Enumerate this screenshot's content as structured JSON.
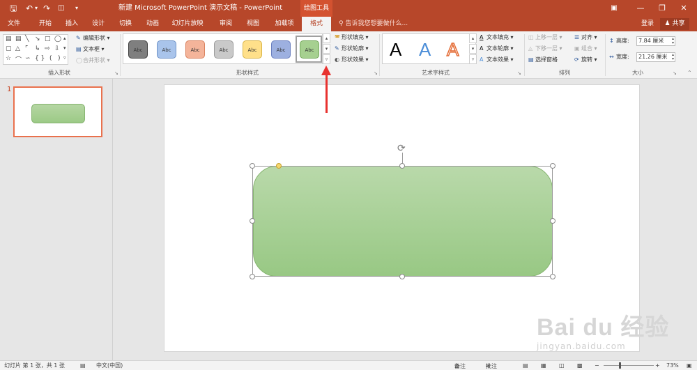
{
  "titlebar": {
    "save_icon": "save-icon",
    "undo_icon": "undo-icon",
    "redo_icon": "redo-icon",
    "present_icon": "present-icon",
    "customize_icon": "customize-icon",
    "title": "新建 Microsoft PowerPoint 演示文稿 - PowerPoint",
    "tool_context": "绘图工具",
    "restore_ribbon_icon": "ribbon-display-icon",
    "minimize": "—",
    "maximize": "❐",
    "close": "✕"
  },
  "tabs": [
    "文件",
    "开始",
    "插入",
    "设计",
    "切换",
    "动画",
    "幻灯片放映",
    "审阅",
    "视图",
    "加载项",
    "格式"
  ],
  "active_tab": "格式",
  "tellme": "告诉我您想要做什么...",
  "account": {
    "login": "登录",
    "share": "共享"
  },
  "ribbon": {
    "insert_shapes": {
      "label": "插入形状",
      "edit_shape": "编辑形状",
      "text_box": "文本框",
      "merge_shapes": "合并形状"
    },
    "shape_styles": {
      "label": "形状样式",
      "swatch_text": "Abc",
      "swatches": [
        {
          "fill": "#7f7f7f",
          "border": "#404040"
        },
        {
          "fill": "#a9c4eb",
          "border": "#6f93c8"
        },
        {
          "fill": "#f4b49a",
          "border": "#d9825f"
        },
        {
          "fill": "#c9c9c9",
          "border": "#9a9a9a"
        },
        {
          "fill": "#ffe08a",
          "border": "#d8b446"
        },
        {
          "fill": "#9db0e0",
          "border": "#6a7fbf"
        },
        {
          "fill": "#a6d090",
          "border": "#74a95c"
        }
      ],
      "shape_fill": "形状填充",
      "shape_outline": "形状轮廓",
      "shape_effects": "形状效果"
    },
    "wordart": {
      "label": "艺术字样式",
      "sample": "A",
      "text_fill": "文本填充",
      "text_outline": "文本轮廓",
      "text_effects": "文本效果"
    },
    "arrange": {
      "label": "排列",
      "bring_forward": "上移一层",
      "send_backward": "下移一层",
      "selection_pane": "选择窗格",
      "align": "对齐",
      "group": "组合",
      "rotate": "旋转"
    },
    "size": {
      "label": "大小",
      "height_label": "高度:",
      "height_value": "7.84 厘米",
      "width_label": "宽度:",
      "width_value": "21.26 厘米"
    }
  },
  "slides": {
    "current_number": "1"
  },
  "watermark": {
    "main": "Bai du 经验",
    "sub": "jingyan.baidu.com"
  },
  "statusbar": {
    "slide_info": "幻灯片 第 1 张，共 1 张",
    "language": "中文(中国)",
    "notes": "备注",
    "comments": "批注",
    "zoom": "73%"
  }
}
